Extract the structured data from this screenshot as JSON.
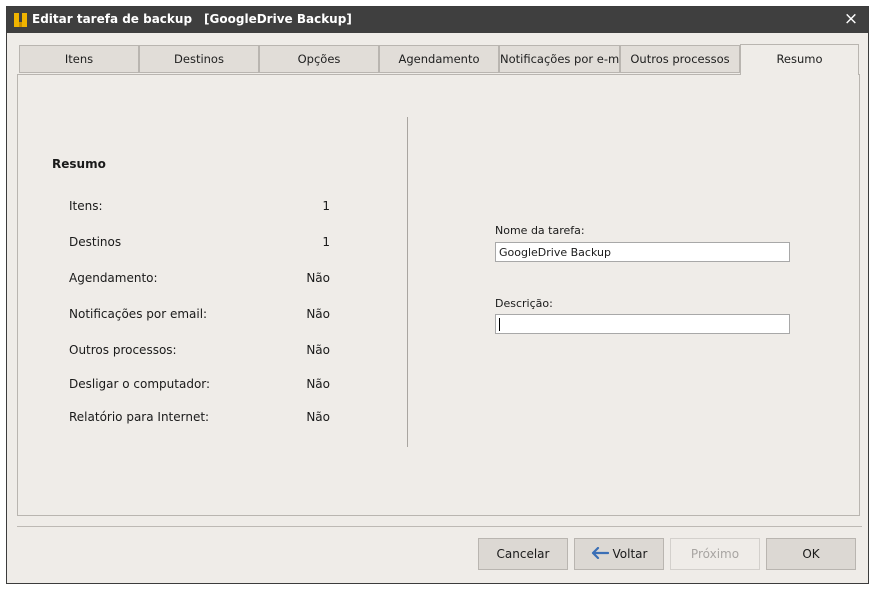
{
  "window": {
    "title": "Editar tarefa de backup",
    "subtitle": "[GoogleDrive Backup]",
    "close_symbol": "×",
    "app_icon": "backup-app-icon"
  },
  "tabs": [
    {
      "label": "Itens",
      "active": false
    },
    {
      "label": "Destinos",
      "active": false
    },
    {
      "label": "Opções",
      "active": false
    },
    {
      "label": "Agendamento",
      "active": false
    },
    {
      "label": "Notificações por e-mail",
      "active": false
    },
    {
      "label": "Outros processos",
      "active": false
    },
    {
      "label": "Resumo",
      "active": true
    }
  ],
  "summary": {
    "title": "Resumo",
    "rows": [
      {
        "label": "Itens:",
        "value": "1"
      },
      {
        "label": "Destinos",
        "value": "1"
      },
      {
        "label": "Agendamento:",
        "value": "Não"
      },
      {
        "label": "Notificações por email:",
        "value": "Não"
      },
      {
        "label": "Outros processos:",
        "value": "Não"
      },
      {
        "label": "Desligar o computador:",
        "value": "Não"
      },
      {
        "label": "Relatório para Internet:",
        "value": "Não"
      }
    ]
  },
  "form": {
    "task_name_label": "Nome da tarefa:",
    "task_name_value": "GoogleDrive Backup",
    "description_label": "Descrição:",
    "description_value": ""
  },
  "buttons": {
    "cancel": "Cancelar",
    "back": "Voltar",
    "next": "Próximo",
    "ok": "OK"
  },
  "colors": {
    "titlebar": "#3f3f3f",
    "background": "#efece8",
    "tab_inactive": "#e1ddd8",
    "button": "#dcd8d3",
    "back_arrow": "#3b6fb6",
    "icon_yellow": "#f0b400"
  }
}
